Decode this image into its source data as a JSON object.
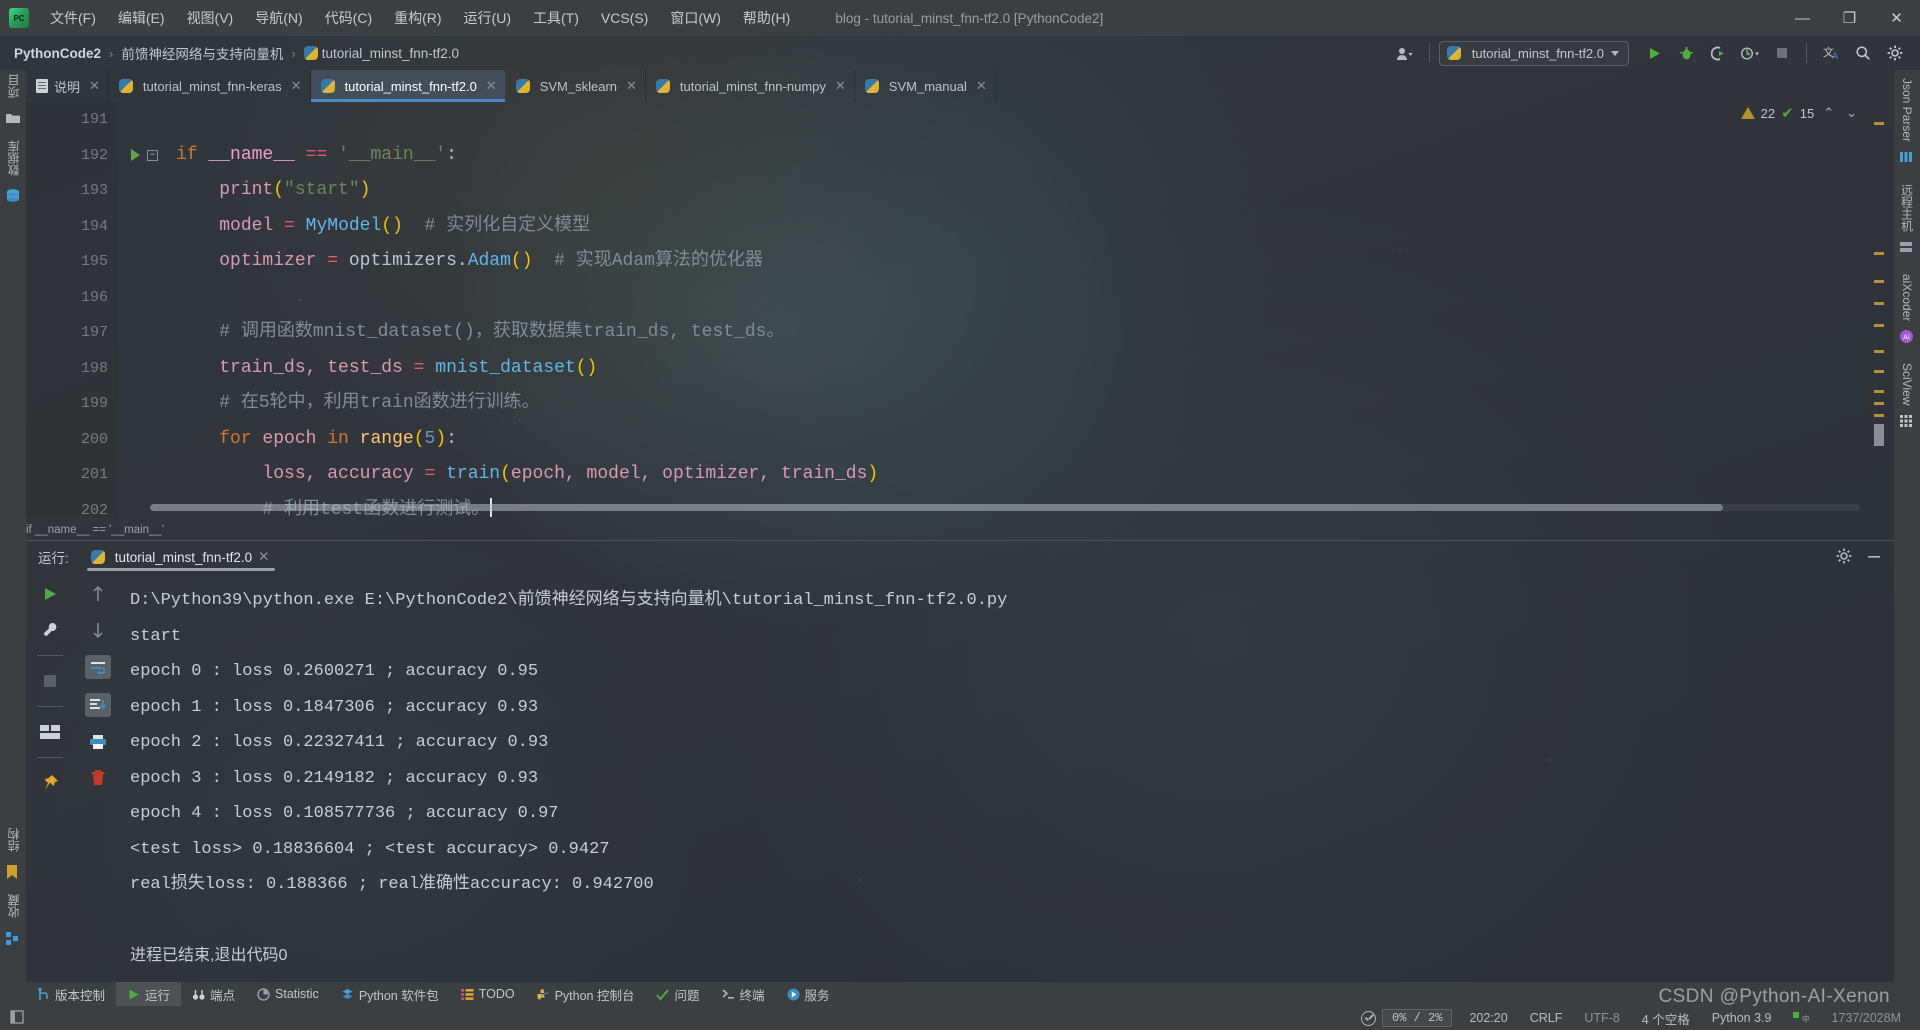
{
  "window": {
    "title": "blog - tutorial_minst_fnn-tf2.0 [PythonCode2]",
    "minimize": "—",
    "maximize": "❐",
    "close": "✕",
    "app_icon": "pycharm-icon"
  },
  "menubar": [
    {
      "label": "文件(F)"
    },
    {
      "label": "编辑(E)"
    },
    {
      "label": "视图(V)"
    },
    {
      "label": "导航(N)"
    },
    {
      "label": "代码(C)"
    },
    {
      "label": "重构(R)"
    },
    {
      "label": "运行(U)"
    },
    {
      "label": "工具(T)"
    },
    {
      "label": "VCS(S)"
    },
    {
      "label": "窗口(W)"
    },
    {
      "label": "帮助(H)"
    }
  ],
  "breadcrumb": {
    "project": "PythonCode2",
    "folder": "前馈神经网络与支持向量机",
    "file": "tutorial_minst_fnn-tf2.0",
    "separator": "›"
  },
  "navbar_right": {
    "account_icon": "user-icon",
    "run_config": "tutorial_minst_fnn-tf2.0",
    "run_icon": "run-icon",
    "debug_icon": "debug-icon",
    "coverage_icon": "run-with-coverage-icon",
    "profile_icon": "profile-icon",
    "stop_icon": "stop-icon",
    "translate_icon": "translate-icon",
    "search_icon": "search-icon",
    "settings_icon": "gear-icon"
  },
  "editor_tabs": [
    {
      "label": "说明",
      "icon": "text-file-icon",
      "active": false
    },
    {
      "label": "tutorial_minst_fnn-keras",
      "icon": "python-file-icon",
      "active": false
    },
    {
      "label": "tutorial_minst_fnn-tf2.0",
      "icon": "python-file-icon",
      "active": true
    },
    {
      "label": "SVM_sklearn",
      "icon": "python-file-icon",
      "active": false
    },
    {
      "label": "tutorial_minst_fnn-numpy",
      "icon": "python-file-icon",
      "active": false
    },
    {
      "label": "SVM_manual",
      "icon": "python-file-icon",
      "active": false
    }
  ],
  "left_strip": [
    {
      "label": "项目",
      "icon": "folder-icon"
    },
    {
      "label": "数据库",
      "icon": "database-icon"
    },
    {
      "label": "结构",
      "icon": "bookmark-icon"
    },
    {
      "label": "收藏",
      "icon": "favorites-icon"
    }
  ],
  "right_strip": [
    {
      "label": "Json Parser",
      "icon": "json-icon"
    },
    {
      "label": "远程主机",
      "icon": "remote-host-icon"
    },
    {
      "label": "aiXcoder",
      "icon": "aixcoder-icon"
    },
    {
      "label": "SciView",
      "icon": "sciview-icon"
    }
  ],
  "editor": {
    "inspection_warnings": "22",
    "inspection_checks": "15",
    "warn_icon": "warning-triangle-icon",
    "ok_icon": "check-icon",
    "prev_icon": "chevron-up-icon",
    "next_icon": "chevron-down-icon",
    "bottom_breadcrumb": "if __name__ == '__main__'",
    "first_line_no": 191,
    "lines": [
      {
        "no": "191",
        "tokens": []
      },
      {
        "no": "192",
        "marker": "run",
        "fold": true,
        "tokens": [
          {
            "t": "if",
            "c": "k-key"
          },
          {
            "t": " ",
            "c": "k-plain"
          },
          {
            "t": "__name__",
            "c": "k-self"
          },
          {
            "t": " ",
            "c": "k-plain"
          },
          {
            "t": "==",
            "c": "k-op"
          },
          {
            "t": " ",
            "c": "k-plain"
          },
          {
            "t": "'__main__'",
            "c": "k-str"
          },
          {
            "t": ":",
            "c": "k-plain"
          }
        ]
      },
      {
        "no": "193",
        "tokens": [
          {
            "t": "    ",
            "c": "k-plain"
          },
          {
            "t": "print",
            "c": "k-var"
          },
          {
            "t": "(",
            "c": "k-paren"
          },
          {
            "t": "\"start\"",
            "c": "k-str"
          },
          {
            "t": ")",
            "c": "k-paren"
          }
        ]
      },
      {
        "no": "194",
        "tokens": [
          {
            "t": "    ",
            "c": "k-plain"
          },
          {
            "t": "model",
            "c": "k-var"
          },
          {
            "t": " ",
            "c": "k-plain"
          },
          {
            "t": "=",
            "c": "k-op"
          },
          {
            "t": " ",
            "c": "k-plain"
          },
          {
            "t": "MyModel",
            "c": "k-cls"
          },
          {
            "t": "()",
            "c": "k-paren"
          },
          {
            "t": "  ",
            "c": "k-plain"
          },
          {
            "t": "# 实列化自定义模型",
            "c": "k-cmt"
          }
        ]
      },
      {
        "no": "195",
        "tokens": [
          {
            "t": "    ",
            "c": "k-plain"
          },
          {
            "t": "optimizer",
            "c": "k-var"
          },
          {
            "t": " ",
            "c": "k-plain"
          },
          {
            "t": "=",
            "c": "k-op"
          },
          {
            "t": " ",
            "c": "k-plain"
          },
          {
            "t": "optimizers.",
            "c": "k-plain"
          },
          {
            "t": "Adam",
            "c": "k-cls"
          },
          {
            "t": "()",
            "c": "k-paren"
          },
          {
            "t": "  ",
            "c": "k-plain"
          },
          {
            "t": "# 实现Adam算法的优化器",
            "c": "k-cmt"
          }
        ]
      },
      {
        "no": "196",
        "tokens": []
      },
      {
        "no": "197",
        "tokens": [
          {
            "t": "    ",
            "c": "k-plain"
          },
          {
            "t": "# 调用函数mnist_dataset()，获取数据集train_ds, test_ds。",
            "c": "k-cmt"
          }
        ]
      },
      {
        "no": "198",
        "tokens": [
          {
            "t": "    ",
            "c": "k-plain"
          },
          {
            "t": "train_ds, test_ds",
            "c": "k-var"
          },
          {
            "t": " ",
            "c": "k-plain"
          },
          {
            "t": "=",
            "c": "k-op"
          },
          {
            "t": " ",
            "c": "k-plain"
          },
          {
            "t": "mnist_dataset",
            "c": "k-cls"
          },
          {
            "t": "()",
            "c": "k-paren"
          }
        ]
      },
      {
        "no": "199",
        "tokens": [
          {
            "t": "    ",
            "c": "k-plain"
          },
          {
            "t": "# 在5轮中，利用train函数进行训练。",
            "c": "k-cmt"
          }
        ]
      },
      {
        "no": "200",
        "tokens": [
          {
            "t": "    ",
            "c": "k-plain"
          },
          {
            "t": "for",
            "c": "k-key"
          },
          {
            "t": " epoch ",
            "c": "k-var"
          },
          {
            "t": "in",
            "c": "k-key"
          },
          {
            "t": " ",
            "c": "k-plain"
          },
          {
            "t": "range",
            "c": "k-fn"
          },
          {
            "t": "(",
            "c": "k-paren"
          },
          {
            "t": "5",
            "c": "k-num"
          },
          {
            "t": ")",
            "c": "k-paren"
          },
          {
            "t": ":",
            "c": "k-plain"
          }
        ]
      },
      {
        "no": "201",
        "tokens": [
          {
            "t": "        ",
            "c": "k-plain"
          },
          {
            "t": "loss, accuracy",
            "c": "k-var"
          },
          {
            "t": " ",
            "c": "k-plain"
          },
          {
            "t": "=",
            "c": "k-op"
          },
          {
            "t": " ",
            "c": "k-plain"
          },
          {
            "t": "train",
            "c": "k-cls"
          },
          {
            "t": "(",
            "c": "k-paren"
          },
          {
            "t": "epoch, model, optimizer, train_ds",
            "c": "k-var"
          },
          {
            "t": ")",
            "c": "k-paren"
          }
        ]
      },
      {
        "no": "202",
        "tokens": [
          {
            "t": "        ",
            "c": "k-plain"
          },
          {
            "t": "# 利用test函数进行测试。",
            "c": "k-cmt"
          }
        ],
        "caret": true
      }
    ]
  },
  "run_panel": {
    "title": "运行:",
    "tab_label": "tutorial_minst_fnn-tf2.0",
    "tab_icon": "python-file-icon",
    "close_icon": "close-icon",
    "settings_icon": "gear-icon",
    "hide_icon": "minimize-icon",
    "tools_left": [
      {
        "name": "rerun-icon"
      },
      {
        "name": "wrench-icon"
      },
      {
        "name": "stop-icon"
      },
      {
        "name": "layout-icon"
      },
      {
        "name": "pin-icon"
      }
    ],
    "tools_right": [
      {
        "name": "arrow-up-icon"
      },
      {
        "name": "arrow-down-icon"
      },
      {
        "name": "soft-wrap-icon"
      },
      {
        "name": "scroll-to-end-icon"
      },
      {
        "name": "print-icon"
      },
      {
        "name": "trash-icon"
      }
    ],
    "output": [
      {
        "text": "D:\\Python39\\python.exe E:\\PythonCode2\\前馈神经网络与支持向量机\\tutorial_minst_fnn-tf2.0.py",
        "zh": false
      },
      {
        "text": "start",
        "zh": false
      },
      {
        "text": "epoch 0 : loss 0.2600271 ; accuracy 0.95",
        "zh": false
      },
      {
        "text": "epoch 1 : loss 0.1847306 ; accuracy 0.93",
        "zh": false
      },
      {
        "text": "epoch 2 : loss 0.22327411 ; accuracy 0.93",
        "zh": false
      },
      {
        "text": "epoch 3 : loss 0.2149182 ; accuracy 0.93",
        "zh": false
      },
      {
        "text": "epoch 4 : loss 0.108577736 ; accuracy 0.97",
        "zh": false
      },
      {
        "text": "<test loss> 0.18836604 ; <test accuracy> 0.9427",
        "zh": false
      },
      {
        "text": "real损失loss: 0.188366 ; real准确性accuracy: 0.942700",
        "zh": false
      },
      {
        "text": "",
        "zh": false
      },
      {
        "text": "进程已结束,退出代码0",
        "zh": true
      }
    ]
  },
  "bottom_bar": [
    {
      "label": "版本控制",
      "icon": "branch-icon",
      "active": false
    },
    {
      "label": "运行",
      "icon": "run-icon",
      "active": true
    },
    {
      "label": "端点",
      "icon": "breakpoints-icon",
      "active": false
    },
    {
      "label": "Statistic",
      "icon": "statistic-icon",
      "active": false
    },
    {
      "label": "Python 软件包",
      "icon": "packages-icon",
      "active": false
    },
    {
      "label": "TODO",
      "icon": "todo-icon",
      "active": false
    },
    {
      "label": "Python 控制台",
      "icon": "python-console-icon",
      "active": false
    },
    {
      "label": "问题",
      "icon": "problems-icon",
      "active": false
    },
    {
      "label": "终端",
      "icon": "terminal-icon",
      "active": false
    },
    {
      "label": "服务",
      "icon": "services-icon",
      "active": false
    }
  ],
  "status_bar": {
    "notification_icon": "event-log-icon",
    "memory": "0% /  2%",
    "position": "202:20",
    "line_separator": "CRLF",
    "encoding": "UTF-8",
    "indent": "4 个空格",
    "interpreter": "Python 3.9",
    "heap": "1737/2028M",
    "ime_icon": "ime-icon"
  },
  "watermark": {
    "text": "CSDN @Python-AI-Xenon"
  },
  "colors": {
    "accent": "#4a88c7",
    "run_green": "#57a64a",
    "warn": "#b5922d",
    "panel": "#3c3f41"
  }
}
